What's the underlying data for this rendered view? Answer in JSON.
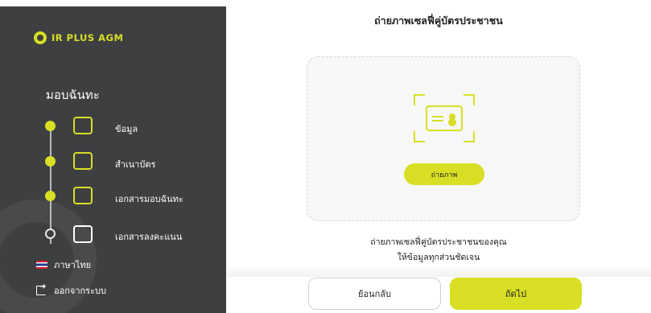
{
  "app": {
    "brand": "IR PLUS AGM"
  },
  "sidebar": {
    "title": "มอบฉันทะ",
    "steps": [
      {
        "label": "ข้อมูล",
        "icon": "clipboard-icon",
        "state": "done"
      },
      {
        "label": "สำเนาบัตร",
        "icon": "id-card-icon",
        "state": "done"
      },
      {
        "label": "เอกสารมอบฉันทะ",
        "icon": "proxy-document-icon",
        "state": "done"
      },
      {
        "label": "เอกสารลงคะแนน",
        "icon": "vote-box-icon",
        "state": "pending"
      }
    ],
    "language": "ภาษาไทย",
    "logout": "ออกจากระบบ"
  },
  "main": {
    "title": "ถ่ายภาพเซลฟี่คู่บัตรประชาชน",
    "capture_button": "ถ่ายภาพ",
    "hint_line1": "ถ่ายภาพเซลฟี่คู่บัตรประชาชนของคุณ",
    "hint_line2": "ให้ข้อมูลทุกส่วนชัดเจน",
    "back_button": "ย้อนกลับ",
    "next_button": "ถัดไป"
  },
  "colors": {
    "accent": "#d8df24",
    "sidebar_bg": "#3e3f41",
    "flag_red": "#d61b2b",
    "flag_blue": "#1e3b8c"
  }
}
